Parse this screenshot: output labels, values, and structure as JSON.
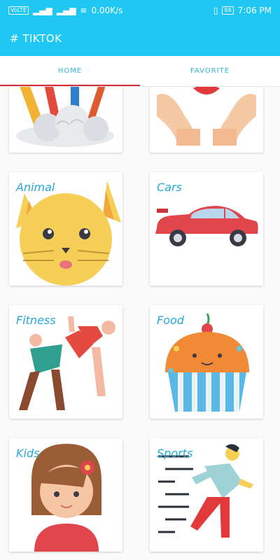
{
  "status_bar": {
    "carrier": "VoLTE",
    "speed": "0.00K/s",
    "battery": "84",
    "time": "7:06 PM"
  },
  "app_bar": {
    "title": "# TIKTOK"
  },
  "tabs": [
    {
      "label": "HOME",
      "selected": true
    },
    {
      "label": "FAVORITE",
      "selected": false
    }
  ],
  "categories": [
    {
      "label": "",
      "icon": "weather-rainbow-cloud-icon"
    },
    {
      "label": "",
      "icon": "heart-hands-icon"
    },
    {
      "label": "Animal",
      "icon": "cat-icon"
    },
    {
      "label": "Cars",
      "icon": "car-icon"
    },
    {
      "label": "Fitness",
      "icon": "fitness-icon"
    },
    {
      "label": "Food",
      "icon": "cupcake-icon"
    },
    {
      "label": "Kids",
      "icon": "girl-icon"
    },
    {
      "label": "Sports",
      "icon": "runner-icon"
    }
  ],
  "colors": {
    "primary": "#1ec8f2",
    "accent_indicator": "#d22b3b",
    "label": "#25a8d8"
  }
}
